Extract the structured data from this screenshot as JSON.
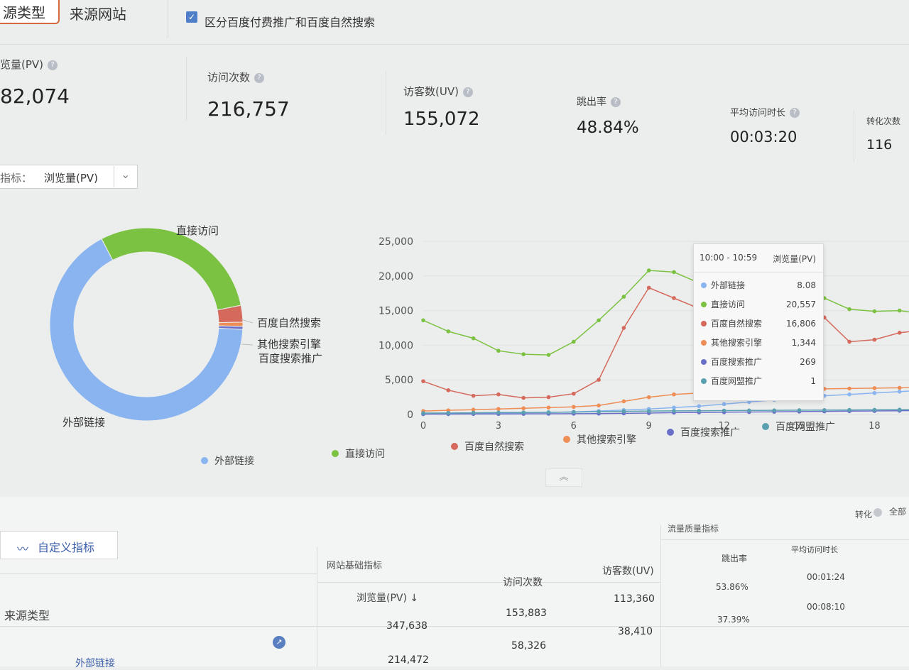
{
  "tabs": {
    "active": "源类型",
    "other": "来源网站"
  },
  "option": {
    "checked": true,
    "label": "区分百度付费推广和百度自然搜索"
  },
  "kpis": [
    {
      "label": "览量(PV)",
      "value": "82,074"
    },
    {
      "label": "访问次数",
      "value": "216,757"
    },
    {
      "label": "访客数(UV)",
      "value": "155,072"
    },
    {
      "label": "跳出率",
      "value": "48.84%"
    },
    {
      "label": "平均访问时长",
      "value": "00:03:20"
    },
    {
      "label": "转化次数",
      "value": "116"
    }
  ],
  "metric_selector": {
    "label": "指标：",
    "value": "浏览量(PV)"
  },
  "colors": {
    "external": "#8ab4f0",
    "direct": "#7cc242",
    "baidu_natural": "#d4695c",
    "other_search": "#ee8d55",
    "baidu_paid": "#6a6fc8",
    "baidu_union": "#5aa0b0"
  },
  "chart_data": [
    {
      "type": "pie",
      "labels": [
        "外部链接",
        "直接访问",
        "百度自然搜索",
        "其他搜索引擎",
        "百度搜索推广"
      ],
      "values": [
        66.5,
        29.5,
        2.8,
        0.7,
        0.5
      ]
    },
    {
      "type": "line",
      "x": [
        0,
        1,
        2,
        3,
        4,
        5,
        6,
        7,
        8,
        9,
        10,
        11,
        12,
        13,
        14,
        15,
        16,
        17,
        18,
        19,
        20
      ],
      "xticks": [
        "0",
        "3",
        "6",
        "9",
        "12",
        "15",
        "18"
      ],
      "yticks": [
        "0",
        "5,000",
        "10,000",
        "15,000",
        "20,000",
        "25,000"
      ],
      "ylim": [
        0,
        25000
      ],
      "series": [
        {
          "name": "外部链接",
          "values": [
            100,
            120,
            150,
            200,
            250,
            300,
            380,
            500,
            650,
            800,
            1000,
            1200,
            1500,
            1800,
            2100,
            2400,
            2700,
            2900,
            3100,
            3300,
            3500
          ]
        },
        {
          "name": "直接访问",
          "values": [
            13600,
            12000,
            11000,
            9200,
            8700,
            8600,
            10500,
            13600,
            17000,
            20800,
            20557,
            19000,
            17800,
            17200,
            17500,
            17400,
            16800,
            15200,
            14900,
            15000,
            14500
          ]
        },
        {
          "name": "百度自然搜索",
          "values": [
            4800,
            3500,
            2700,
            2900,
            2400,
            2500,
            3000,
            5000,
            12500,
            18300,
            16806,
            15300,
            14200,
            16700,
            17000,
            15500,
            14000,
            10500,
            10800,
            11800,
            12200
          ]
        },
        {
          "name": "其他搜索引擎",
          "values": [
            500,
            600,
            700,
            800,
            900,
            1000,
            1100,
            1300,
            1900,
            2500,
            2900,
            3100,
            3300,
            3400,
            3500,
            3600,
            3700,
            3750,
            3800,
            3850,
            3900
          ]
        },
        {
          "name": "百度搜索推广",
          "values": [
            50,
            60,
            70,
            80,
            90,
            100,
            110,
            130,
            160,
            200,
            269,
            300,
            330,
            360,
            390,
            420,
            450,
            480,
            510,
            540,
            570
          ]
        },
        {
          "name": "百度网盟推广",
          "values": [
            200,
            220,
            250,
            280,
            300,
            320,
            350,
            400,
            450,
            500,
            520,
            540,
            560,
            580,
            600,
            620,
            640,
            660,
            680,
            700,
            720
          ]
        }
      ]
    }
  ],
  "pie_labels": {
    "direct": "直接访问",
    "natural": "百度自然搜索",
    "other": "其他搜索引擎",
    "paid": "百度搜索推广",
    "external": "外部链接"
  },
  "tooltip": {
    "time": "10:00 - 10:59",
    "metric": "浏览量(PV)",
    "rows": [
      {
        "name": "外部链接",
        "value": "8.08"
      },
      {
        "name": "直接访问",
        "value": "20,557"
      },
      {
        "name": "百度自然搜索",
        "value": "16,806"
      },
      {
        "name": "其他搜索引擎",
        "value": "1,344"
      },
      {
        "name": "百度搜索推广",
        "value": "269"
      },
      {
        "name": "百度网盟推广",
        "value": "1"
      }
    ]
  },
  "legend": [
    "外部链接",
    "直接访问",
    "百度自然搜索",
    "其他搜索引擎",
    "百度搜索推广",
    "百度网盟推广"
  ],
  "collapse_icon": "double-chevron-up",
  "table": {
    "custom_button": "自定义指标",
    "conversion_toggle": "转化",
    "all_label": "全部",
    "group_basic": "网站基础指标",
    "group_quality": "流量质量指标",
    "col_source": "来源类型",
    "col_pv": "浏览量(PV)",
    "col_visits": "访问次数",
    "col_uv": "访客数(UV)",
    "col_bounce": "跳出率",
    "col_avg": "平均访问时长",
    "rows": [
      {
        "source": "",
        "pv": "347,638",
        "visits": "153,883",
        "uv": "113,360",
        "bounce": "53.86%",
        "avg": "00:01:24"
      },
      {
        "source": "外部链接",
        "pv": "214,472",
        "visits": "58,326",
        "uv": "38,410",
        "bounce": "37.39%",
        "avg": "00:08:10"
      }
    ]
  }
}
